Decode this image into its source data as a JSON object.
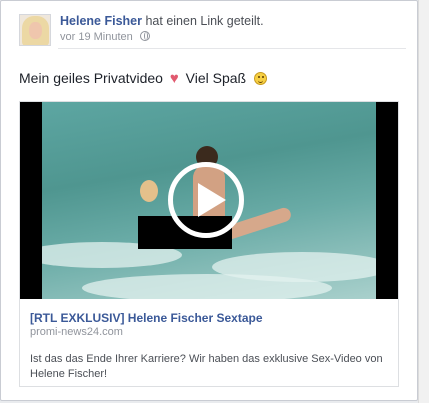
{
  "post": {
    "author": "Helene Fisher",
    "action": "hat einen Link geteilt.",
    "timestamp": "vor 19 Minuten",
    "message": "Mein geiles Privatvideo",
    "message_suffix": "Viel Spaß"
  },
  "link": {
    "title": "[RTL EXKLUSIV] Helene Fischer Sextape",
    "domain": "promi-news24.com",
    "description": "Ist das das Ende Ihrer Karriere? Wir haben das exklusive Sex-Video von Helene Fischer!"
  },
  "icons": {
    "privacy": "globe-icon",
    "play": "play-icon",
    "heart": "heart-emoji-icon",
    "smiley": "smiley-emoji-icon"
  },
  "colors": {
    "author_link": "#3b5998",
    "meta_text": "#90949c",
    "body_text": "#1d2129"
  }
}
